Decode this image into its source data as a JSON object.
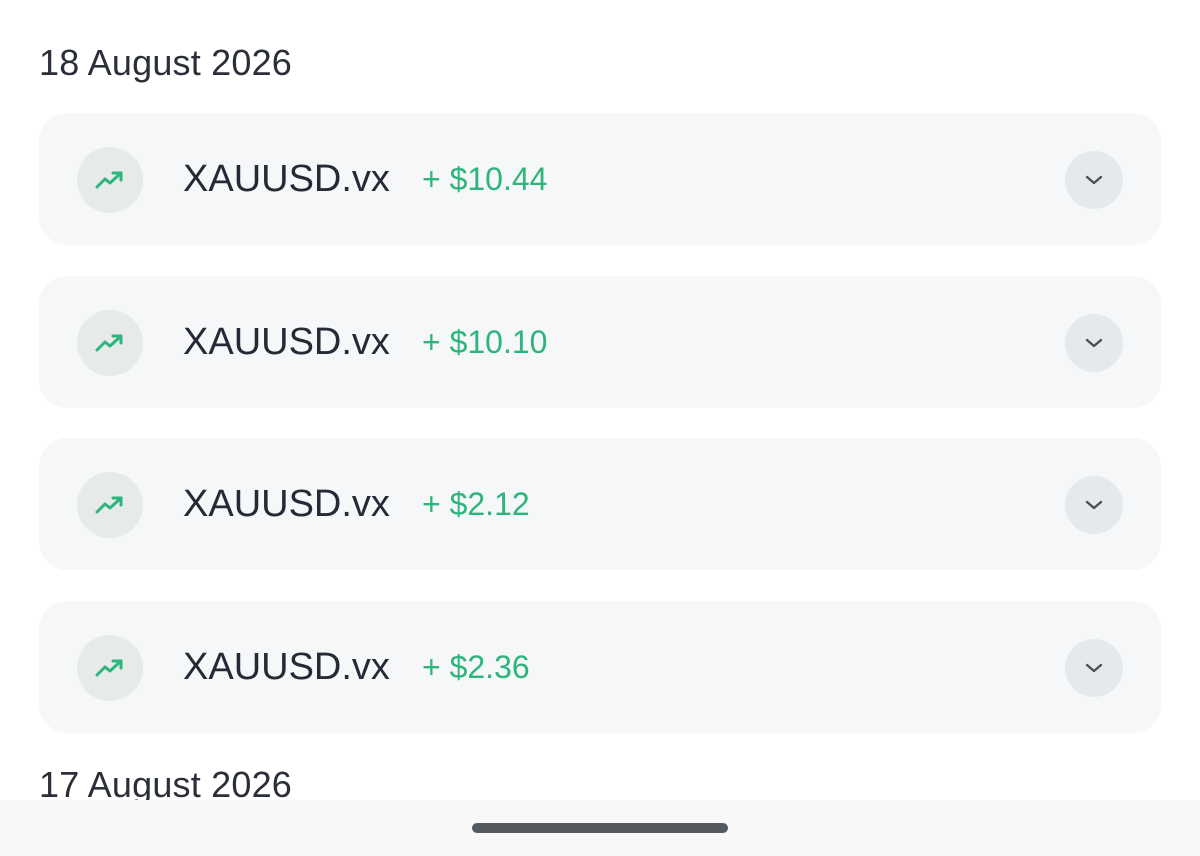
{
  "groups": [
    {
      "date": "18 August 2026",
      "trades": [
        {
          "symbol": "XAUUSD.vx",
          "profit": "+ $10.44",
          "trend_icon": "trending-up-icon"
        },
        {
          "symbol": "XAUUSD.vx",
          "profit": "+ $10.10",
          "trend_icon": "trending-up-icon"
        },
        {
          "symbol": "XAUUSD.vx",
          "profit": "+ $2.12",
          "trend_icon": "trending-up-icon"
        },
        {
          "symbol": "XAUUSD.vx",
          "profit": "+ $2.36",
          "trend_icon": "trending-up-icon"
        }
      ]
    },
    {
      "date": "17 August 2026",
      "trades": []
    }
  ],
  "colors": {
    "profit_positive": "#2db57c",
    "card_background": "#f5f7f8",
    "badge_background": "#e6ebea",
    "text_primary": "#252a36"
  },
  "icons": {
    "trend": "trending-up-icon",
    "expand": "chevron-down-icon"
  }
}
